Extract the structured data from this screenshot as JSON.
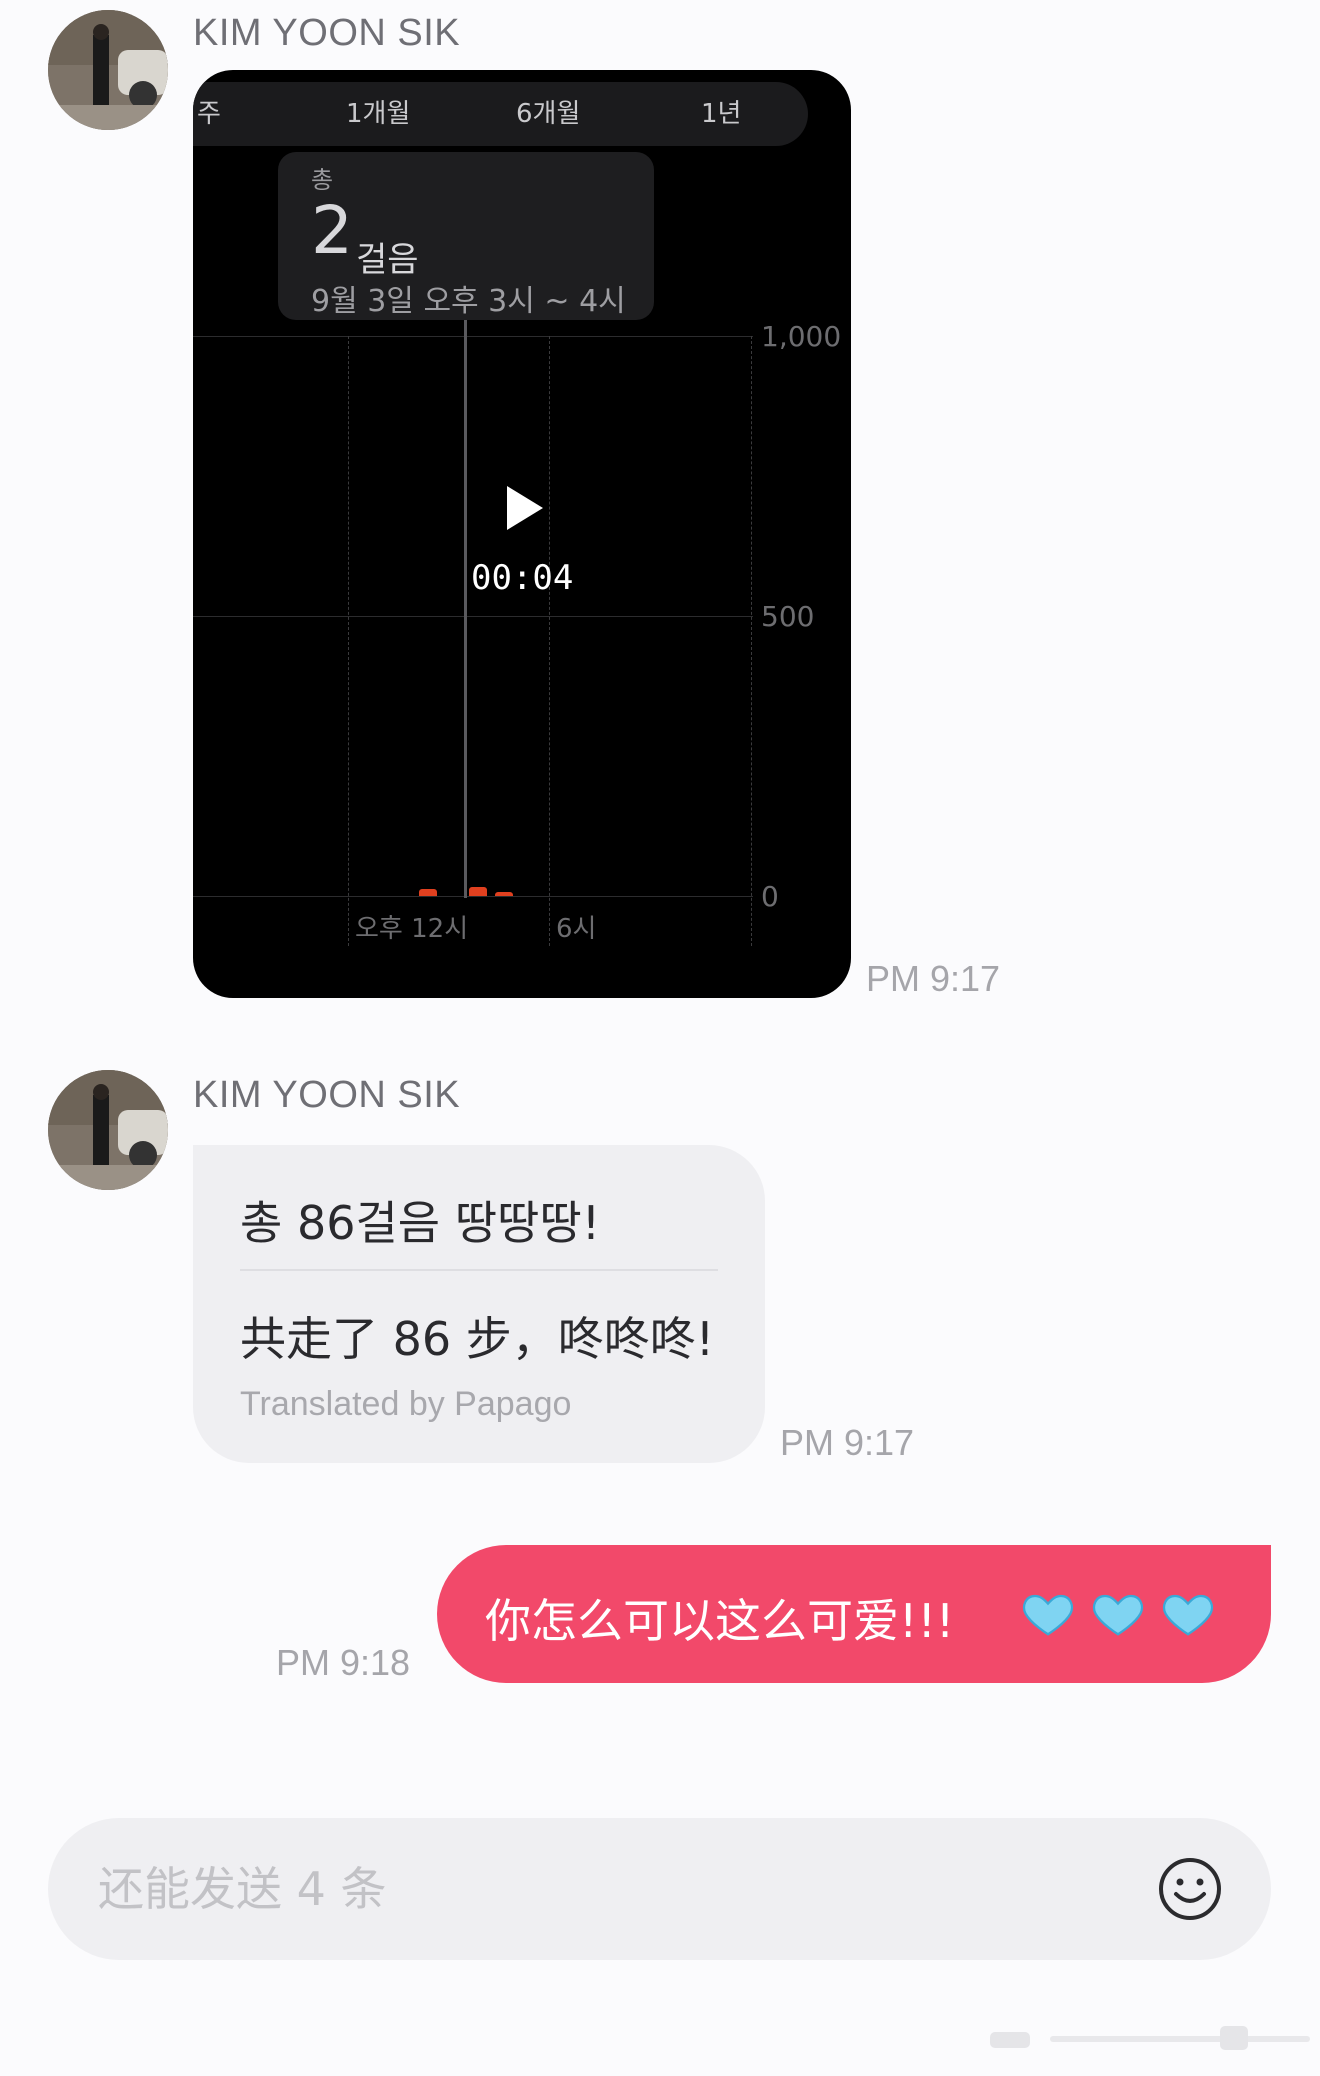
{
  "messages": [
    {
      "sender": "KIM YOON SIK",
      "time": "PM 9:17",
      "video": {
        "duration": "00:04",
        "range_tabs": [
          "주",
          "1개월",
          "6개월",
          "1년"
        ],
        "tooltip": {
          "label": "총",
          "value": "2",
          "unit": "걸음",
          "date": "9월 3일 오후 3시 ~ 4시"
        },
        "chart_data": {
          "type": "bar",
          "y_ticks": [
            "1,000",
            "500",
            "0"
          ],
          "x_ticks": [
            "오후 12시",
            "6시"
          ],
          "ylim": [
            0,
            1000
          ],
          "bar_color": "#e0401f",
          "values": [
            40,
            52,
            18
          ]
        }
      }
    },
    {
      "sender": "KIM YOON SIK",
      "time": "PM 9:17",
      "text": "총 86걸음 땅땅땅!",
      "translation": "共走了 86 步，咚咚咚!",
      "translation_note": "Translated by Papago"
    },
    {
      "outgoing": true,
      "time": "PM 9:18",
      "text": "你怎么可以这么可爱!!!",
      "emoji": [
        "blue-heart",
        "blue-heart",
        "blue-heart"
      ],
      "bubble_color": "#f2496a"
    }
  ],
  "composer": {
    "placeholder": "还能发送 4 条",
    "emoji_icon": "smiley-icon"
  }
}
